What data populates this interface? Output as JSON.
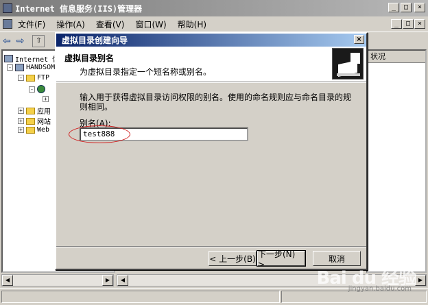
{
  "window": {
    "title": "Internet 信息服务(IIS)管理器",
    "controls": [
      "_",
      "□",
      "×"
    ]
  },
  "menubar": {
    "items": [
      "文件(F)",
      "操作(A)",
      "查看(V)",
      "窗口(W)",
      "帮助(H)"
    ],
    "mdi_controls": [
      "_",
      "□",
      "×"
    ]
  },
  "tree": {
    "root": "Internet 信",
    "server": "HANDSOM",
    "ftp": "FTP",
    "app": "应用",
    "site": "网站",
    "web": "Web"
  },
  "right_pane": {
    "column_header": "状况"
  },
  "wizard": {
    "title": "虚拟目录创建向导",
    "close": "×",
    "heading": "虚拟目录别名",
    "subheading": "为虚拟目录指定一个短名称或别名。",
    "description": "输入用于获得虚拟目录访问权限的别名。使用的命名规则应与命名目录的规则相同。",
    "alias_label": "别名(A):",
    "alias_value": "test888",
    "back_button": "< 上一步(B)",
    "next_button": "下一步(N) >",
    "cancel_button": "取消"
  },
  "watermark": {
    "text": "Bai du 经验",
    "url": "jingyan.baidu.com"
  }
}
